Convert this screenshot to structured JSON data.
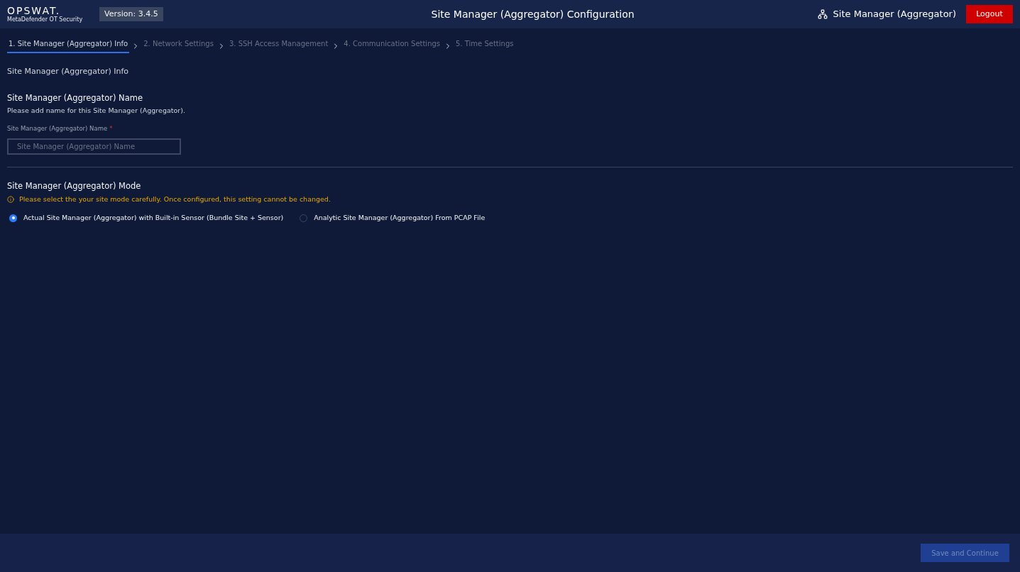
{
  "header": {
    "logo": "OPSWAT.",
    "product": "MetaDefender OT Security",
    "version": "Version: 3.4.5",
    "title": "Site Manager (Aggregator) Configuration",
    "role": "Site Manager (Aggregator)",
    "logout": "Logout"
  },
  "steps": [
    {
      "label": "1. Site Manager (Aggregator) Info",
      "selected": true
    },
    {
      "label": "2. Network Settings",
      "selected": false
    },
    {
      "label": "3. SSH Access Management",
      "selected": false
    },
    {
      "label": "4. Communication Settings",
      "selected": false
    },
    {
      "label": "5. Time Settings",
      "selected": false
    }
  ],
  "section_title": "Site Manager (Aggregator) Info",
  "name_section": {
    "heading": "Site Manager (Aggregator) Name",
    "description": "Please add name for this Site Manager (Aggregator).",
    "field_label": "Site Manager (Aggregator) Name",
    "required_mark": "*",
    "placeholder": "Site Manager (Aggregator) Name"
  },
  "mode_section": {
    "heading": "Site Manager (Aggregator) Mode",
    "warning": "Please select the your site mode carefully. Once configured, this setting cannot be changed.",
    "options": [
      {
        "label": "Actual Site Manager (Aggregator) with Built-in Sensor (Bundle Site + Sensor)",
        "selected": true
      },
      {
        "label": "Analytic Site Manager (Aggregator) From PCAP File",
        "selected": false
      }
    ]
  },
  "footer": {
    "button": "Save and Continue",
    "disabled": true
  }
}
